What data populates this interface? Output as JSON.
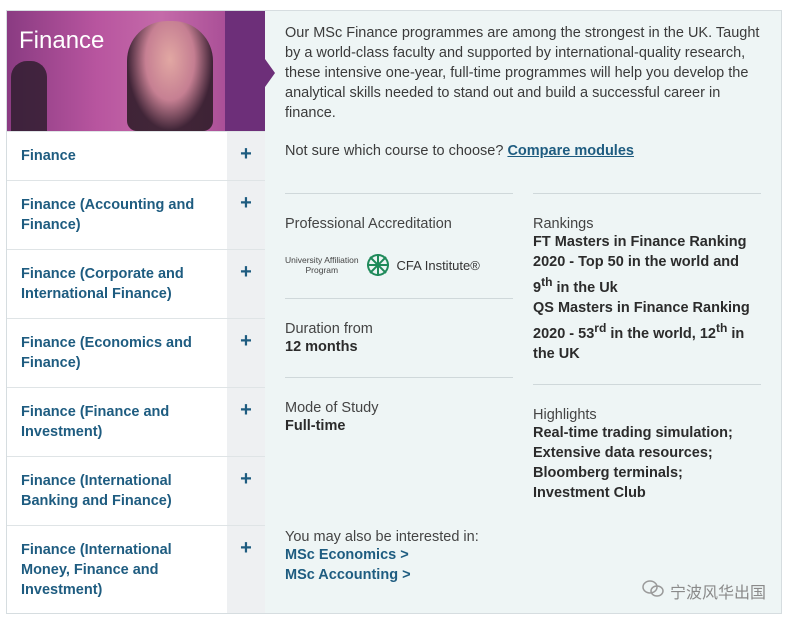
{
  "hero": {
    "title": "Finance"
  },
  "courses": [
    {
      "label": "Finance"
    },
    {
      "label": "Finance (Accounting and Finance)"
    },
    {
      "label": "Finance (Corporate and International Finance)"
    },
    {
      "label": "Finance (Economics and Finance)"
    },
    {
      "label": "Finance (Finance and Investment)"
    },
    {
      "label": "Finance (International Banking and Finance)"
    },
    {
      "label": "Finance (International Money, Finance and Investment)"
    }
  ],
  "expand_symbol": "+",
  "intro": "Our MSc Finance programmes are among the strongest in the UK. Taught by a world-class faculty and supported by international-quality research, these intensive one-year, full-time programmes will help you develop the analytical skills needed to stand out and build a successful career in finance.",
  "compare": {
    "prompt": "Not sure which course to choose?",
    "link": "Compare modules"
  },
  "accreditation": {
    "label": "Professional Accreditation",
    "affiliation_line1": "University Affiliation",
    "affiliation_line2": "Program",
    "institute": "CFA Institute®"
  },
  "duration": {
    "label": "Duration from",
    "value": "12 months"
  },
  "mode": {
    "label": "Mode of Study",
    "value": "Full-time"
  },
  "rankings": {
    "label": "Rankings",
    "ft_a": "FT Masters in Finance Ranking 2020 - Top 50 in the world and 9",
    "ft_sup": "th",
    "ft_b": " in the Uk",
    "qs_a": "QS Masters in Finance Ranking 2020 - 53",
    "qs_sup1": "rd",
    "qs_b": " in the world, 12",
    "qs_sup2": "th",
    "qs_c": " in the UK"
  },
  "highlights": {
    "label": "Highlights",
    "value": "Real-time trading simulation; Extensive data resources; Bloomberg terminals; Investment Club"
  },
  "interest": {
    "label": "You may also be interested in:",
    "links": [
      "MSc Economics  >",
      "MSc Accounting  >"
    ]
  },
  "watermark": {
    "text": "宁波风华出国",
    "icon": "wechat-icon"
  }
}
